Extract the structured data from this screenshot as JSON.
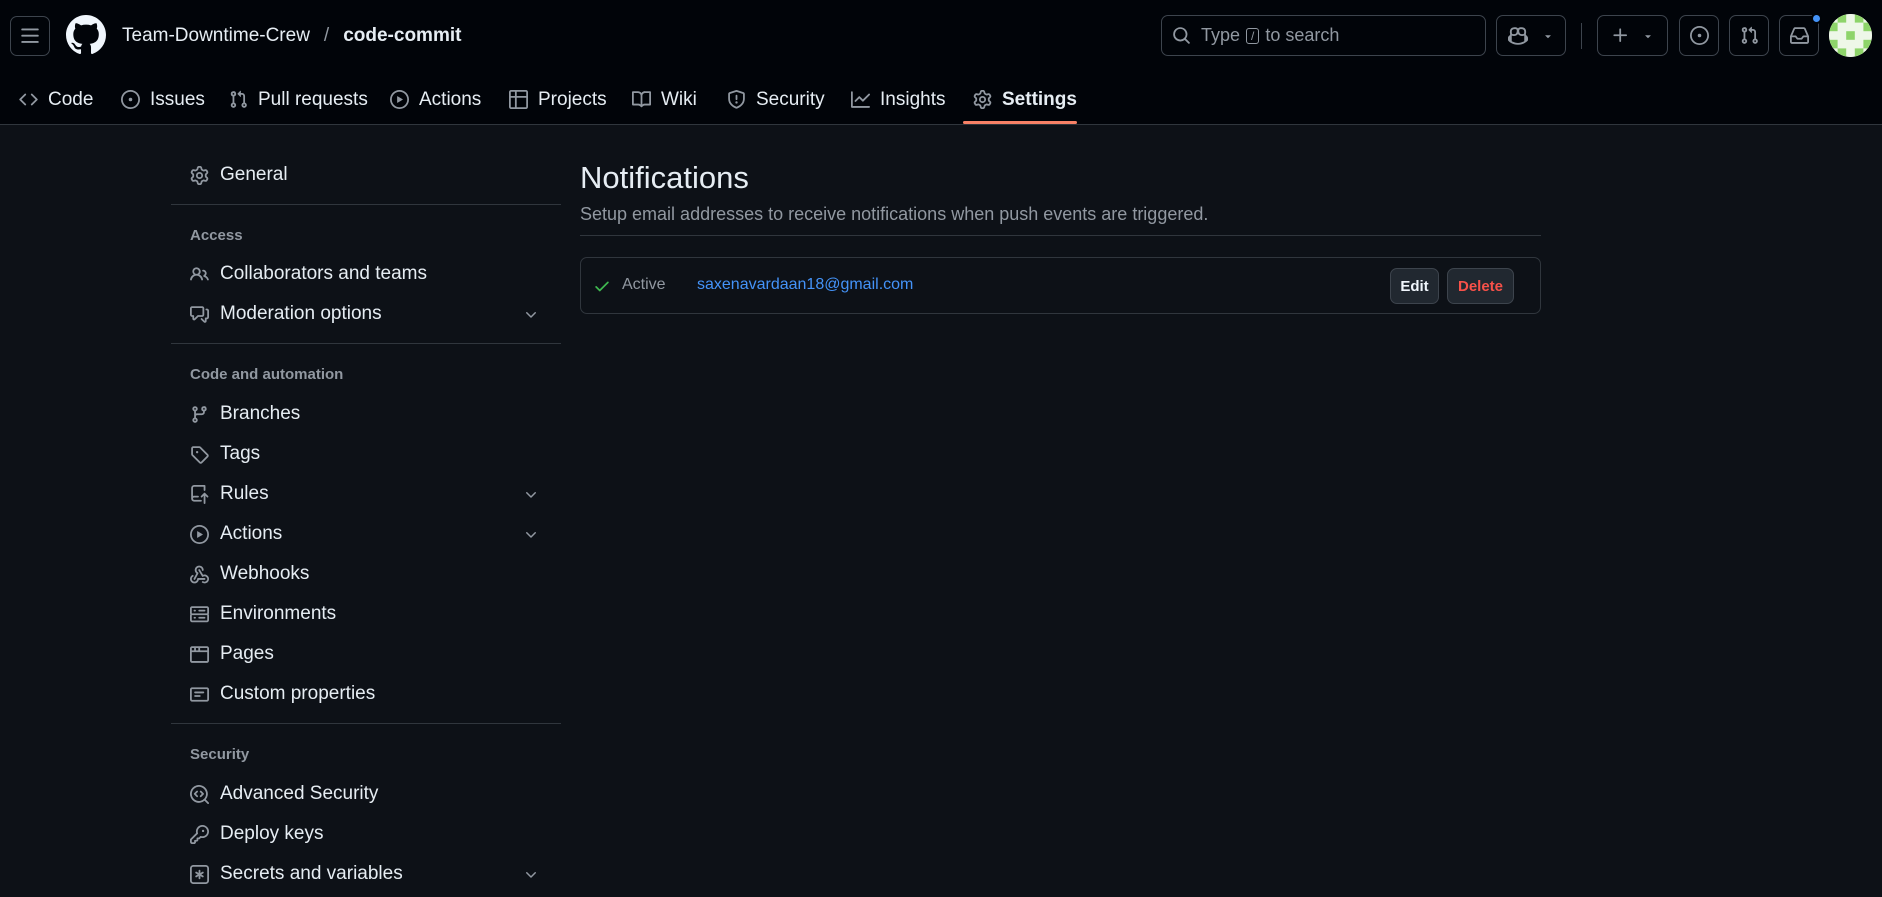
{
  "header": {
    "owner": "Team-Downtime-Crew",
    "separator": "/",
    "repo": "code-commit",
    "search_prefix": "Type",
    "search_key": "/",
    "search_suffix": "to search"
  },
  "repo_nav": {
    "tabs": [
      {
        "label": "Code",
        "icon": "code-icon"
      },
      {
        "label": "Issues",
        "icon": "issue-opened-icon"
      },
      {
        "label": "Pull requests",
        "icon": "git-pull-request-icon"
      },
      {
        "label": "Actions",
        "icon": "play-icon"
      },
      {
        "label": "Projects",
        "icon": "table-icon"
      },
      {
        "label": "Wiki",
        "icon": "book-icon"
      },
      {
        "label": "Security",
        "icon": "shield-icon"
      },
      {
        "label": "Insights",
        "icon": "graph-icon"
      },
      {
        "label": "Settings",
        "icon": "gear-icon",
        "active": true
      }
    ]
  },
  "sidebar": {
    "general": "General",
    "access_heading": "Access",
    "access": [
      {
        "label": "Collaborators and teams",
        "icon": "people-icon"
      },
      {
        "label": "Moderation options",
        "icon": "comment-discussion-icon",
        "expandable": true
      }
    ],
    "code_heading": "Code and automation",
    "code": [
      {
        "label": "Branches",
        "icon": "git-branch-icon"
      },
      {
        "label": "Tags",
        "icon": "tag-icon"
      },
      {
        "label": "Rules",
        "icon": "repo-push-icon",
        "expandable": true
      },
      {
        "label": "Actions",
        "icon": "play-icon",
        "expandable": true
      },
      {
        "label": "Webhooks",
        "icon": "webhook-icon"
      },
      {
        "label": "Environments",
        "icon": "server-icon"
      },
      {
        "label": "Pages",
        "icon": "browser-icon"
      },
      {
        "label": "Custom properties",
        "icon": "note-icon"
      }
    ],
    "security_heading": "Security",
    "security": [
      {
        "label": "Advanced Security",
        "icon": "codescan-icon"
      },
      {
        "label": "Deploy keys",
        "icon": "key-icon"
      },
      {
        "label": "Secrets and variables",
        "icon": "key-asterisk-icon",
        "expandable": true
      }
    ]
  },
  "main": {
    "title": "Notifications",
    "subtitle": "Setup email addresses to receive notifications when push events are triggered.",
    "entry": {
      "status": "Active",
      "email": "saxenavardaan18@gmail.com",
      "edit_label": "Edit",
      "delete_label": "Delete"
    }
  },
  "colors": {
    "background": "#0d1117",
    "header_background": "#010409",
    "accent_underline": "#f78166",
    "link": "#4493f8",
    "success": "#3fb950",
    "danger": "#f85149"
  }
}
